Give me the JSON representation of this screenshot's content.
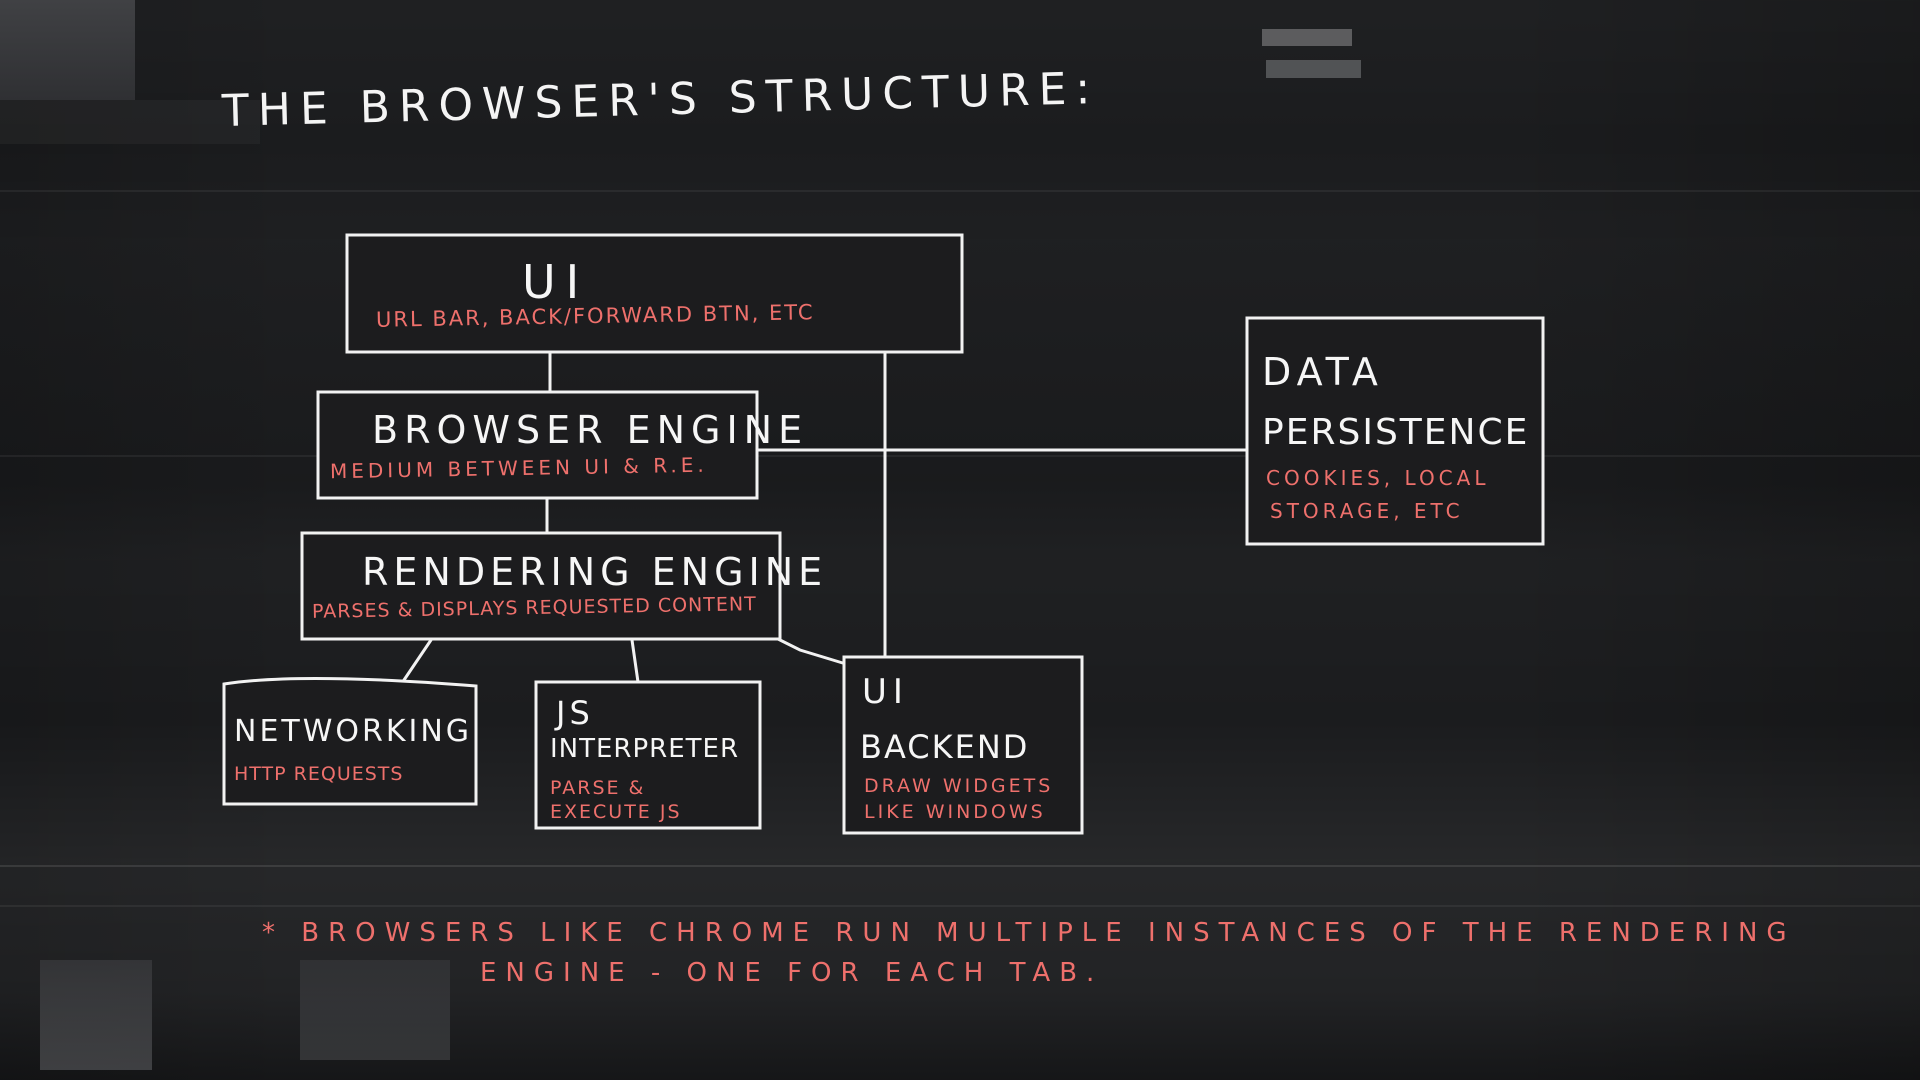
{
  "title": "THE BROWSER'S STRUCTURE:",
  "colors": {
    "background": "#1b1c1e",
    "box_fill": "#1c1c1e",
    "line": "#f2f2f2",
    "title_text": "#f6f6f6",
    "description_text": "#ee706c"
  },
  "nodes": {
    "ui": {
      "title": "UI",
      "description": "URL BAR, BACK/FORWARD BTN, ETC"
    },
    "browser_engine": {
      "title": "BROWSER ENGINE",
      "description": "MEDIUM BETWEEN UI & R.E."
    },
    "rendering_engine": {
      "title": "RENDERING ENGINE",
      "description": "PARSES & DISPLAYS REQUESTED CONTENT"
    },
    "networking": {
      "title": "NETWORKING",
      "description": "HTTP REQUESTS"
    },
    "js_interpreter": {
      "title_line1": "JS",
      "title_line2": "INTERPRETER",
      "description_line1": "PARSE &",
      "description_line2": "EXECUTE JS"
    },
    "ui_backend": {
      "title_line1": "UI",
      "title_line2": "BACKEND",
      "description_line1": "DRAW WIDGETS",
      "description_line2": "LIKE WINDOWS"
    },
    "data_persistence": {
      "title_line1": "DATA",
      "title_line2": "PERSISTENCE",
      "description_line1": "COOKIES, LOCAL",
      "description_line2": "STORAGE, ETC"
    }
  },
  "edges": [
    {
      "from": "UI",
      "to": "BROWSER ENGINE"
    },
    {
      "from": "UI",
      "to": "UI BACKEND"
    },
    {
      "from": "BROWSER ENGINE",
      "to": "RENDERING ENGINE"
    },
    {
      "from": "BROWSER ENGINE",
      "to": "DATA PERSISTENCE"
    },
    {
      "from": "RENDERING ENGINE",
      "to": "NETWORKING"
    },
    {
      "from": "RENDERING ENGINE",
      "to": "JS INTERPRETER"
    },
    {
      "from": "RENDERING ENGINE",
      "to": "UI BACKEND"
    }
  ],
  "footnote": {
    "line1": "* BROWSERS LIKE CHROME RUN MULTIPLE INSTANCES OF THE RENDERING",
    "line2": "ENGINE - ONE FOR EACH TAB."
  }
}
